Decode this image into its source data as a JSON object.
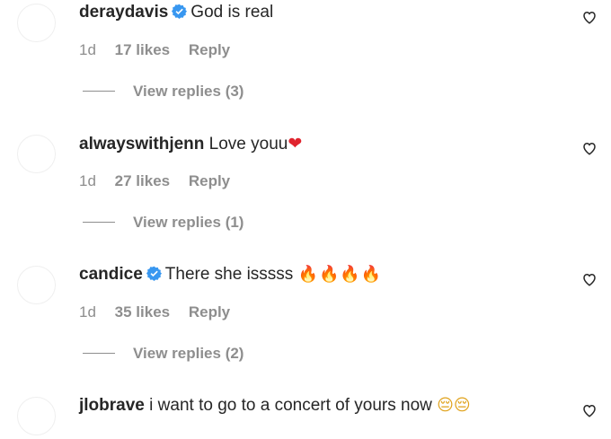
{
  "comments": [
    {
      "username": "deraydavis",
      "verified": true,
      "text": "God is real",
      "emoji": "",
      "age": "1d",
      "likes": "17 likes",
      "reply": "Reply",
      "replies_label": "View replies (3)"
    },
    {
      "username": "alwayswithjenn",
      "verified": false,
      "text": "Love youu",
      "emoji": "❤",
      "age": "1d",
      "likes": "27 likes",
      "reply": "Reply",
      "replies_label": "View replies (1)"
    },
    {
      "username": "candice",
      "verified": true,
      "text": "There she isssss",
      "emoji": "🔥🔥🔥🔥",
      "age": "1d",
      "likes": "35 likes",
      "reply": "Reply",
      "replies_label": "View replies (2)"
    },
    {
      "username": "jlobrave",
      "verified": false,
      "text": "i want to go to a concert of yours now",
      "emoji": "😔😔",
      "age": "",
      "likes": "",
      "reply": "",
      "replies_label": ""
    }
  ],
  "colors": {
    "text": "#262626",
    "muted": "#8e8e8e",
    "verified_blue": "#3897f0"
  },
  "icons": {
    "verified": "verified-badge-icon",
    "like": "heart-outline-icon"
  }
}
